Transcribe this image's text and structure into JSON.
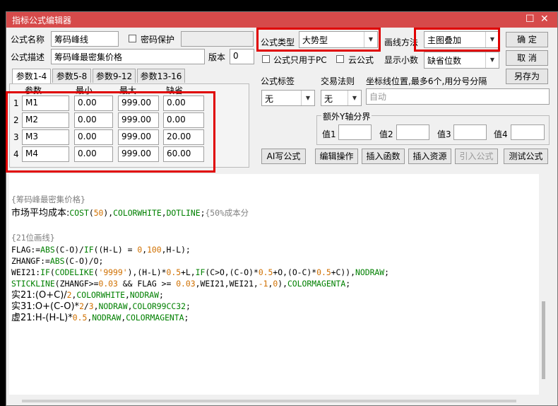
{
  "window": {
    "title": "指标公式编辑器",
    "max_icon": "maximize-icon",
    "close_icon": "close-icon"
  },
  "form": {
    "name_label": "公式名称",
    "name_value": "筹码峰线",
    "password_label": "密码保护",
    "desc_label": "公式描述",
    "desc_value": "筹码峰最密集价格",
    "version_label": "版本",
    "version_value": "0",
    "type_label": "公式类型",
    "type_value": "大势型",
    "draw_label": "画线方法",
    "draw_value": "主图叠加",
    "pc_only_label": "公式只用于PC",
    "cloud_label": "云公式",
    "decimals_label": "显示小数",
    "decimals_value": "缺省位数",
    "ok": "确 定",
    "cancel": "取 消",
    "save_as": "另存为"
  },
  "param_tabs": [
    "参数1-4",
    "参数5-8",
    "参数9-12",
    "参数13-16"
  ],
  "param_headers": [
    "参数",
    "最小",
    "最大",
    "缺省"
  ],
  "params": [
    {
      "idx": "1",
      "name": "M1",
      "min": "0.00",
      "max": "999.00",
      "def": "0.00"
    },
    {
      "idx": "2",
      "name": "M2",
      "min": "0.00",
      "max": "999.00",
      "def": "0.00"
    },
    {
      "idx": "3",
      "name": "M3",
      "min": "0.00",
      "max": "999.00",
      "def": "20.00"
    },
    {
      "idx": "4",
      "name": "M4",
      "min": "0.00",
      "max": "999.00",
      "def": "60.00"
    }
  ],
  "mark": {
    "label": "公式标签",
    "value": "无"
  },
  "trade": {
    "label": "交易法则",
    "value": "无"
  },
  "coord": {
    "label": "坐标线位置,最多6个,用分号分隔",
    "value": "自动"
  },
  "yaxis": {
    "title": "额外Y轴分界",
    "labels": [
      "值1",
      "值2",
      "值3",
      "值4"
    ]
  },
  "actions": [
    "AI写公式",
    "编辑操作",
    "插入函数",
    "插入资源",
    "引入公式",
    "测试公式"
  ],
  "code_lines": [
    [
      {
        "t": "{筹码峰最密集价格}",
        "c": "gray"
      }
    ],
    [
      {
        "t": "市场平均成本:",
        "c": "black",
        "cn": true
      },
      {
        "t": "COST",
        "c": "green"
      },
      {
        "t": "(",
        "c": "black"
      },
      {
        "t": "50",
        "c": "orange"
      },
      {
        "t": "),",
        "c": "black"
      },
      {
        "t": "COLORWHITE",
        "c": "green"
      },
      {
        "t": ",",
        "c": "black"
      },
      {
        "t": "DOTLINE",
        "c": "green"
      },
      {
        "t": ";",
        "c": "black"
      },
      {
        "t": "{50%成本分",
        "c": "gray"
      }
    ],
    [
      {
        "t": "",
        "c": "black"
      }
    ],
    [
      {
        "t": "{21位画线}",
        "c": "gray"
      }
    ],
    [
      {
        "t": "FLAG:=",
        "c": "black"
      },
      {
        "t": "ABS",
        "c": "green"
      },
      {
        "t": "(C-O)/",
        "c": "black"
      },
      {
        "t": "IF",
        "c": "green"
      },
      {
        "t": "((H-L) = ",
        "c": "black"
      },
      {
        "t": "0",
        "c": "orange"
      },
      {
        "t": ",",
        "c": "black"
      },
      {
        "t": "100",
        "c": "orange"
      },
      {
        "t": ",H-L);",
        "c": "black"
      }
    ],
    [
      {
        "t": "ZHANGF:=",
        "c": "black"
      },
      {
        "t": "ABS",
        "c": "green"
      },
      {
        "t": "(C-O)/O;",
        "c": "black"
      }
    ],
    [
      {
        "t": "WEI21:",
        "c": "black"
      },
      {
        "t": "IF",
        "c": "green"
      },
      {
        "t": "(",
        "c": "black"
      },
      {
        "t": "CODELIKE",
        "c": "green"
      },
      {
        "t": "(",
        "c": "black"
      },
      {
        "t": "'9999'",
        "c": "orange"
      },
      {
        "t": "),(H-L)*",
        "c": "black"
      },
      {
        "t": "0.5",
        "c": "orange"
      },
      {
        "t": "+L,",
        "c": "black"
      },
      {
        "t": "IF",
        "c": "green"
      },
      {
        "t": "(C>O,(C-O)*",
        "c": "black"
      },
      {
        "t": "0.5",
        "c": "orange"
      },
      {
        "t": "+O,(O-C)*",
        "c": "black"
      },
      {
        "t": "0.5",
        "c": "orange"
      },
      {
        "t": "+C)),",
        "c": "black"
      },
      {
        "t": "NODRAW",
        "c": "green"
      },
      {
        "t": ";",
        "c": "black"
      }
    ],
    [
      {
        "t": "STICKLINE",
        "c": "green"
      },
      {
        "t": "(ZHANGF>=",
        "c": "black"
      },
      {
        "t": "0.03",
        "c": "orange"
      },
      {
        "t": " && FLAG >= ",
        "c": "black"
      },
      {
        "t": "0.03",
        "c": "orange"
      },
      {
        "t": ",WEI21,WEI21,",
        "c": "black"
      },
      {
        "t": "-1",
        "c": "orange"
      },
      {
        "t": ",",
        "c": "black"
      },
      {
        "t": "0",
        "c": "orange"
      },
      {
        "t": "),",
        "c": "black"
      },
      {
        "t": "COLORMAGENTA",
        "c": "green"
      },
      {
        "t": ";",
        "c": "black"
      }
    ],
    [
      {
        "t": "实21:(O+C)/",
        "c": "black",
        "cn": true
      },
      {
        "t": "2",
        "c": "orange"
      },
      {
        "t": ",",
        "c": "black"
      },
      {
        "t": "COLORWHITE",
        "c": "green"
      },
      {
        "t": ",",
        "c": "black"
      },
      {
        "t": "NODRAW",
        "c": "green"
      },
      {
        "t": ";",
        "c": "black"
      }
    ],
    [
      {
        "t": "实31:O+(C-O)*",
        "c": "black",
        "cn": true
      },
      {
        "t": "2",
        "c": "orange"
      },
      {
        "t": "/",
        "c": "black"
      },
      {
        "t": "3",
        "c": "orange"
      },
      {
        "t": ",",
        "c": "black"
      },
      {
        "t": "NODRAW",
        "c": "green"
      },
      {
        "t": ",",
        "c": "black"
      },
      {
        "t": "COLOR99CC32",
        "c": "green"
      },
      {
        "t": ";",
        "c": "black"
      }
    ],
    [
      {
        "t": "虚21:H-(H-L)*",
        "c": "black",
        "cn": true
      },
      {
        "t": "0.5",
        "c": "orange"
      },
      {
        "t": ",",
        "c": "black"
      },
      {
        "t": "NODRAW",
        "c": "green"
      },
      {
        "t": ",",
        "c": "black"
      },
      {
        "t": "COLORMAGENTA",
        "c": "green"
      },
      {
        "t": ";",
        "c": "black"
      }
    ]
  ],
  "colors": {
    "titlebar": "#d64a4a",
    "highlight": "#e00000",
    "func": "#008000",
    "number": "#d07000",
    "comment": "#808080"
  }
}
